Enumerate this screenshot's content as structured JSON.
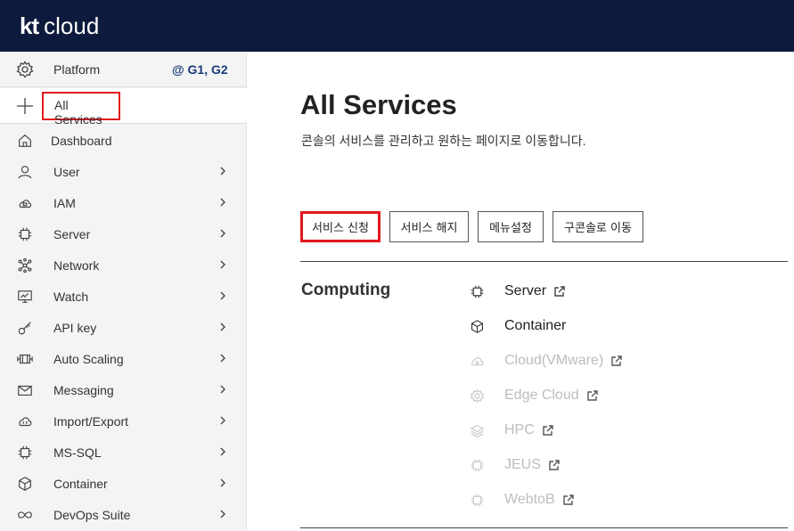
{
  "header": {
    "logo_kt": "kt",
    "logo_cloud": "cloud"
  },
  "sidebar": {
    "platform_label": "Platform",
    "region": "@ G1, G2",
    "all_services_label": "All Services",
    "items": [
      {
        "label": "Dashboard",
        "icon": "home-icon",
        "chevron": false
      },
      {
        "label": "User",
        "icon": "user-icon",
        "chevron": true
      },
      {
        "label": "IAM",
        "icon": "cloud-lock-icon",
        "chevron": true
      },
      {
        "label": "Server",
        "icon": "chip-icon",
        "chevron": true
      },
      {
        "label": "Network",
        "icon": "network-icon",
        "chevron": true
      },
      {
        "label": "Watch",
        "icon": "monitor-chart-icon",
        "chevron": true
      },
      {
        "label": "API key",
        "icon": "key-icon",
        "chevron": true
      },
      {
        "label": "Auto Scaling",
        "icon": "scaling-icon",
        "chevron": true
      },
      {
        "label": "Messaging",
        "icon": "envelope-icon",
        "chevron": true
      },
      {
        "label": "Import/Export",
        "icon": "cloud-transfer-icon",
        "chevron": true
      },
      {
        "label": "MS-SQL",
        "icon": "database-chip-icon",
        "chevron": true
      },
      {
        "label": "Container",
        "icon": "cube-icon",
        "chevron": true
      },
      {
        "label": "DevOps Suite",
        "icon": "infinity-icon",
        "chevron": true
      }
    ]
  },
  "main": {
    "title": "All Services",
    "subtitle": "콘솔의 서비스를 관리하고 원하는 페이지로 이동합니다.",
    "buttons": {
      "apply": "서비스 신청",
      "cancel": "서비스 해지",
      "menu_settings": "메뉴설정",
      "old_console": "구콘솔로 이동"
    },
    "category": "Computing",
    "services": [
      {
        "label": "Server",
        "icon": "chip-icon",
        "enabled": true,
        "external": true
      },
      {
        "label": "Container",
        "icon": "cube-icon",
        "enabled": true,
        "external": false
      },
      {
        "label": "Cloud(VMware)",
        "icon": "cloud-icon",
        "enabled": false,
        "external": true
      },
      {
        "label": "Edge Cloud",
        "icon": "gear-chip-icon",
        "enabled": false,
        "external": true
      },
      {
        "label": "HPC",
        "icon": "layers-icon",
        "enabled": false,
        "external": true
      },
      {
        "label": "JEUS",
        "icon": "chip-icon",
        "enabled": false,
        "external": true
      },
      {
        "label": "WebtoB",
        "icon": "chip-icon",
        "enabled": false,
        "external": true
      }
    ]
  },
  "colors": {
    "header_bg": "#0e1a3d",
    "highlight": "#e0191e",
    "region": "#1b3a7a",
    "disabled": "#bdbdbd"
  }
}
